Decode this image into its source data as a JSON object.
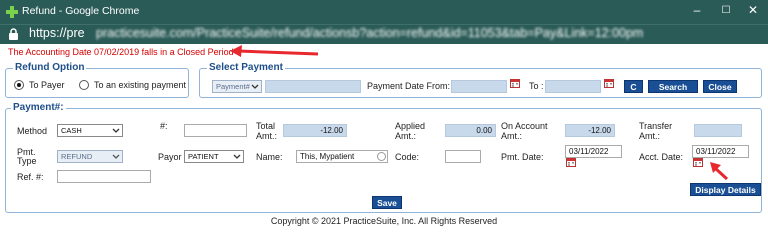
{
  "window": {
    "title": "Refund - Google Chrome",
    "min": "–",
    "max": "☐",
    "close": "✕"
  },
  "address": {
    "url_prefix": "https://pre",
    "url_rest": "practicesuite.com/PracticeSuite/refund/actionsb?action=refund&id=11053&tab=Pay&Link=12:00pm"
  },
  "warning": "The Accounting Date 07/02/2019 falls in a Closed Period",
  "refund_option": {
    "legend": "Refund Option",
    "to_payer": "To Payer",
    "to_existing": "To an existing payment"
  },
  "select_payment": {
    "legend": "Select Payment",
    "payment_select": "Payment#",
    "payment_date_from_label": "Payment Date From:",
    "to_label": "To :",
    "c_button": "C",
    "search_button": "Search",
    "close_button": "Close"
  },
  "payment": {
    "legend": "Payment#:",
    "method_label": "Method",
    "method_value": "CASH",
    "hash_label": "#:",
    "hash_value": "",
    "total_amt_label_1": "Total",
    "total_amt_label_2": "Amt.:",
    "total_amt_value": "-12.00",
    "applied_label_1": "Applied",
    "applied_label_2": "Amt.:",
    "applied_value": "0.00",
    "onaccount_label_1": "On Account",
    "onaccount_label_2": "Amt.:",
    "onaccount_value": "-12.00",
    "transfer_label_1": "Transfer",
    "transfer_label_2": "Amt.:",
    "transfer_value": "",
    "pmt_type_label_1": "Pmt.",
    "pmt_type_label_2": "Type",
    "pmt_type_value": "REFUND",
    "payor_label": "Payor",
    "payor_value": "PATIENT",
    "name_label": "Name:",
    "name_value": "This, Mypatient",
    "code_label": "Code:",
    "code_value": "",
    "pmt_date_label": "Pmt. Date:",
    "pmt_date_value": "03/11/2022",
    "acct_date_label": "Acct. Date:",
    "acct_date_value": "03/11/2022",
    "ref_label": "Ref. #:",
    "ref_value": "",
    "display_details_button": "Display Details",
    "save_button": "Save"
  },
  "footer": "Copyright © 2021 PracticeSuite, Inc. All Rights Reserved",
  "colors": {
    "titlebar": "#2b5b57",
    "accent": "#1a4f95",
    "warning": "#d40000",
    "readonly": "#c9d9ec",
    "arrow": "#e8282f"
  }
}
